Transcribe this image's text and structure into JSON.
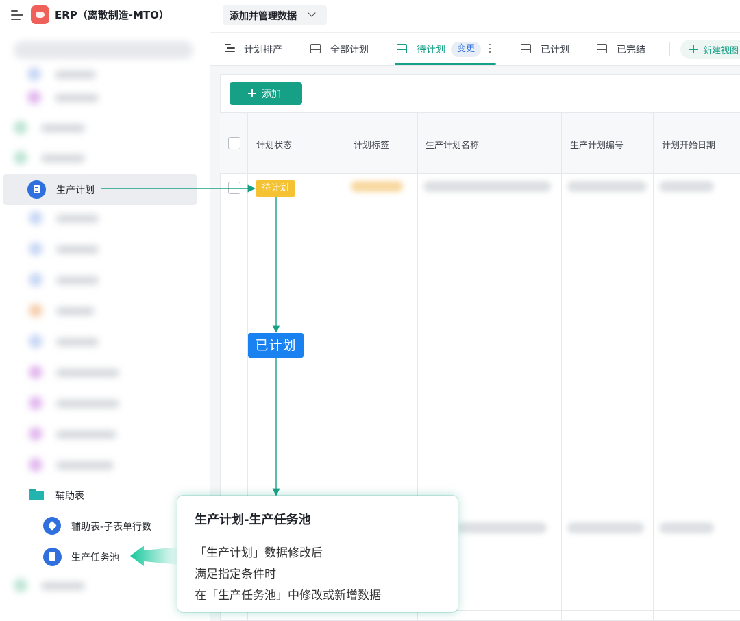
{
  "app": {
    "title": "ERP（离散制造-MTO）",
    "logo_color": "#f0605a"
  },
  "topbar": {
    "data_button_label": "添加并管理数据"
  },
  "tabs": [
    {
      "label": "计划排产",
      "icon": "gantt-icon",
      "active": false
    },
    {
      "label": "全部计划",
      "icon": "table-icon",
      "active": false
    },
    {
      "label": "待计划",
      "icon": "table-icon",
      "active": true,
      "badge": "变更"
    },
    {
      "label": "已计划",
      "icon": "table-icon",
      "active": false
    },
    {
      "label": "已完结",
      "icon": "table-icon",
      "active": false
    }
  ],
  "new_view_label": "新建视图",
  "sidebar": {
    "active_item": {
      "label": "生产计划",
      "icon": "doc-icon"
    },
    "folder": {
      "label": "辅助表",
      "icon": "folder-icon"
    },
    "children": [
      {
        "label": "辅助表-子表单行数",
        "icon": "tag-icon"
      },
      {
        "label": "生产任务池",
        "icon": "doc-icon"
      }
    ]
  },
  "toolbar": {
    "add_label": "添加"
  },
  "table": {
    "columns": [
      "计划状态",
      "计划标签",
      "生产计划名称",
      "生产计划编号",
      "计划开始日期"
    ],
    "first_row_status": "待计划"
  },
  "annotation": {
    "status_change_label": "已计划",
    "callout_title": "生产计划-生产任务池",
    "callout_lines": [
      "「生产计划」数据修改后",
      "满足指定条件时",
      "在「生产任务池」中修改或新增数据"
    ]
  },
  "colors": {
    "accent": "#16a085",
    "pending_tag": "#f4c233",
    "planned_label": "#1a82f0",
    "doc_icon": "#2f6fde"
  }
}
